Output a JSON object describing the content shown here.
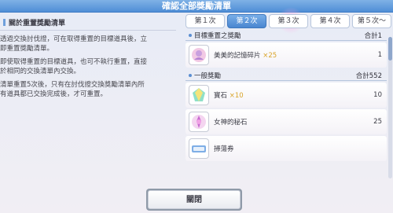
{
  "window": {
    "title": "確認全部獎勵清單"
  },
  "left": {
    "heading": "關於重置獎勵清單",
    "paragraphs": [
      "透過交換討伐證，可在取得重置的目標道具後，立\n即重置獎勵清單。",
      "即使取得重置的目標道具，也可不執行重置，直接\n於相同的交換清單內交換。",
      "清單重置5次後，只有在討伐證交換獎勵清單內所\n有道具都已交換完成後，才可重置。"
    ]
  },
  "tabs": [
    {
      "label": "第１次",
      "active": false
    },
    {
      "label": "第２次",
      "active": true
    },
    {
      "label": "第３次",
      "active": false
    },
    {
      "label": "第４次",
      "active": false
    },
    {
      "label": "第５次～",
      "active": false
    }
  ],
  "groups": {
    "target": {
      "title": "目標重置之獎勵",
      "total": "合計1",
      "items": [
        {
          "name": "美美的記憶碎片",
          "qty": "×25",
          "count": "1",
          "icon": "memory-piece-icon"
        }
      ]
    },
    "general": {
      "title": "一般獎勵",
      "total": "合計552",
      "items": [
        {
          "name": "寶石",
          "qty": "×10",
          "count": "10",
          "icon": "jewel-icon"
        },
        {
          "name": "女神的秘石",
          "qty": "",
          "count": "25",
          "icon": "goddess-stone-icon"
        },
        {
          "name": "掃蕩券",
          "qty": "",
          "count": "",
          "icon": "sweep-ticket-icon"
        }
      ]
    }
  },
  "footer": {
    "close_label": "關閉"
  },
  "colors": {
    "accent": "#4f8ed6",
    "qty": "#d9a42a"
  }
}
